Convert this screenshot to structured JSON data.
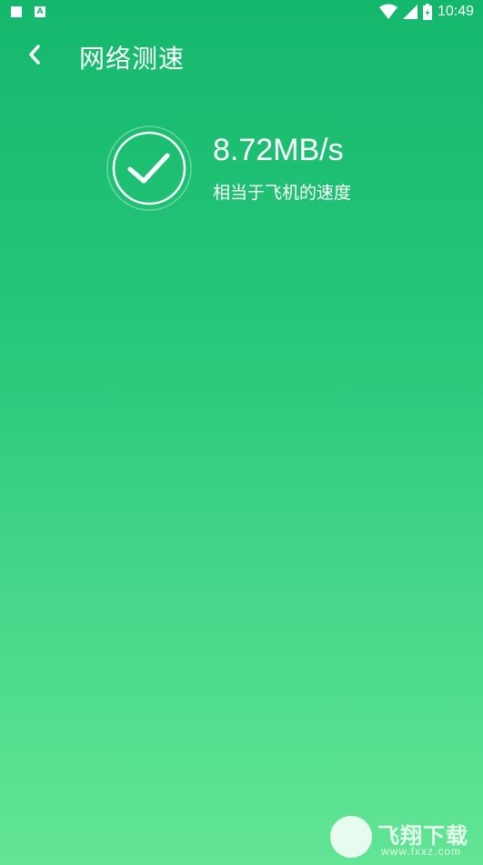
{
  "status_bar": {
    "time": "10:49",
    "notification_icon": "A",
    "icons": [
      "square-notification-icon",
      "a-notification-icon",
      "wifi-icon",
      "signal-icon",
      "battery-icon"
    ]
  },
  "header": {
    "title": "网络测速",
    "back_icon": "chevron-left-icon"
  },
  "result": {
    "icon": "check-circle-icon",
    "speed": "8.72MB/s",
    "comparison": "相当于飞机的速度"
  },
  "watermark": {
    "brand": "飞翔下载",
    "url": "www.fxxz.com"
  },
  "colors": {
    "gradient_top": "#14b86d",
    "gradient_bottom": "#62e594",
    "text": "#ffffff"
  }
}
